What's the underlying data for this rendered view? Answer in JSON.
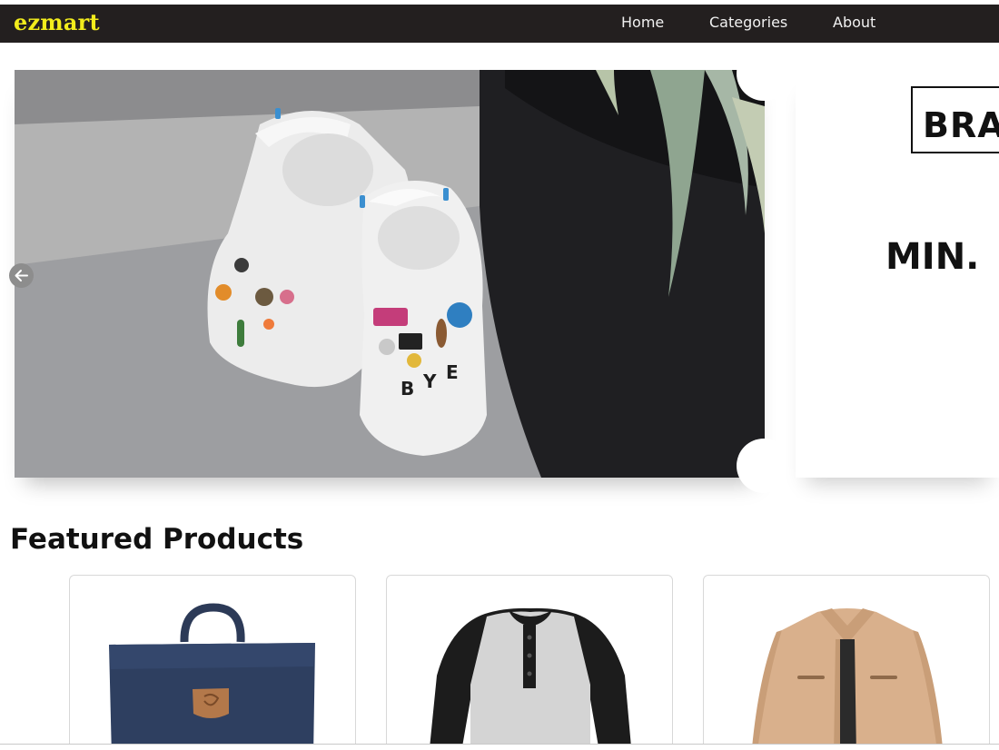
{
  "navbar": {
    "brand": "ezmart",
    "links": [
      {
        "label": "Home"
      },
      {
        "label": "Categories"
      },
      {
        "label": "About"
      }
    ]
  },
  "hero": {
    "slide_2_brand": "BRA",
    "slide_2_text": "MIN."
  },
  "featured": {
    "title": "Featured Products"
  },
  "colors": {
    "navbar_bg": "#231f1f",
    "brand": "#f2ec1c",
    "nav_text": "#f1f1f1"
  }
}
